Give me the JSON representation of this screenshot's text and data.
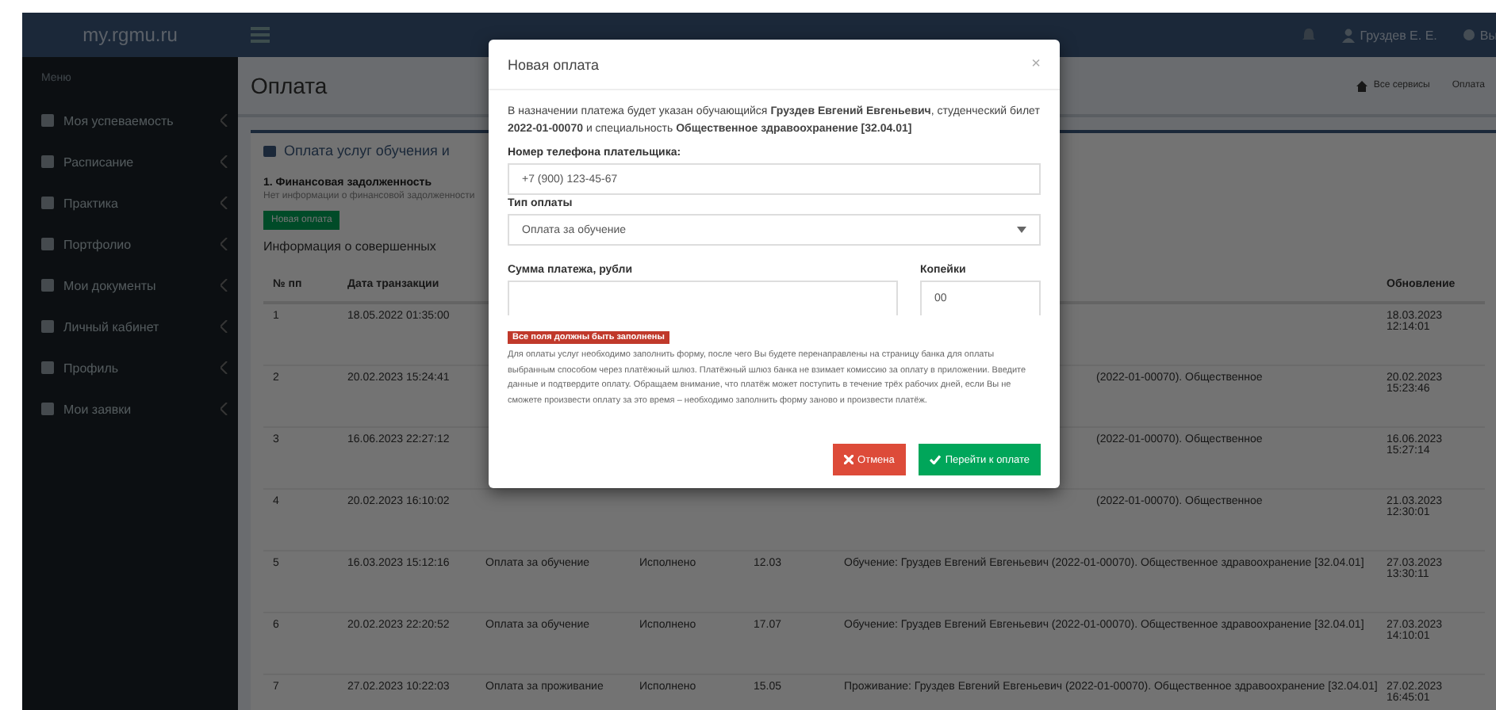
{
  "header": {
    "logo": "my.rgmu.ru",
    "user": "Груздев Е. Е.",
    "logout": "Вы"
  },
  "sidebar": {
    "heading": "Меню",
    "items": [
      {
        "label": "Моя успеваемость"
      },
      {
        "label": "Расписание"
      },
      {
        "label": "Практика"
      },
      {
        "label": "Портфолио"
      },
      {
        "label": "Мои документы"
      },
      {
        "label": "Личный кабинет"
      },
      {
        "label": "Профиль"
      },
      {
        "label": "Мои заявки"
      }
    ]
  },
  "page": {
    "title": "Оплата",
    "breadcrumb": [
      "Все сервисы",
      "Оплата"
    ]
  },
  "panel": {
    "title": "Оплата услуг обучения и",
    "section": "1. Финансовая задолженность",
    "note": "Нет информации о финансовой задолженности",
    "new_button": "Новая оплата",
    "history_title": "Информация о совершенных"
  },
  "table": {
    "columns": {
      "number": "№ пп",
      "date": "Дата транзакции",
      "updated": "Обновление"
    },
    "rows": [
      {
        "number": "1",
        "date": "18.05.2022 01:35:00",
        "updated": "18.03.2023 12:14:01"
      },
      {
        "number": "2",
        "date": "20.02.2023 15:24:41",
        "tail": "(2022-01-00070). Общественное",
        "updated": "20.02.2023 15:23:46"
      },
      {
        "number": "3",
        "date": "16.06.2023 22:27:12",
        "tail": "(2022-01-00070). Общественное",
        "updated": "16.06.2023 15:27:14"
      },
      {
        "number": "4",
        "date": "20.02.2023 16:10:02",
        "tail": "(2022-01-00070). Общественное",
        "updated": "21.03.2023 12:30:01"
      },
      {
        "number": "5",
        "date": "16.03.2023 15:12:16",
        "type": "Оплата за обучение",
        "status": "Исполнено",
        "sum": "12.03",
        "purpose": "Обучение: Груздев Евгений Евгеньевич (2022-01-00070). Общественное здравоохранение [32.04.01]",
        "updated": "27.03.2023 13:30:11"
      },
      {
        "number": "6",
        "date": "20.02.2023 22:20:52",
        "type": "Оплата за обучение",
        "status": "Исполнено",
        "sum": "17.07",
        "purpose": "Обучение: Груздев Евгений Евгеньевич (2022-01-00070). Общественное здравоохранение [32.04.01]",
        "updated": "27.03.2023 14:10:01"
      },
      {
        "number": "7",
        "date": "27.02.2023 10:22:03",
        "type": "Оплата за проживание",
        "status": "Исполнено",
        "sum": "15.05",
        "purpose": "Проживание: Груздев Евгений Евгеньевич (2022-01-00070). Общественное здравоохранение [32.04.01]",
        "updated": "27.02.2023 16:45:01"
      }
    ]
  },
  "modal": {
    "title": "Новая оплата",
    "close": "×",
    "intro": "В назначении платежа будет указан обучающийся **Груздев Евгений Евгеньевич**, студенческий билет **2022-01-00070** и специальность **Общественное здравоохранение [32.04.01]**",
    "phone_label": "Номер телефона плательщика:",
    "phone_value": "+7 (900) 123-45-67",
    "type_label": "Тип оплаты",
    "type_value": "Оплата за обучение",
    "sum_label": "Сумма платежа, рубли",
    "kopeks_label": "Копейки",
    "kopeks_value": "00",
    "error": "Все поля должны быть заполнены",
    "info": "Для оплаты услуг необходимо заполнить форму, после чего Вы будете перенаправлены на страницу банка для оплаты выбранным способом через платёжный шлюз. Платёжный шлюз банка не взимает комиссию за оплату в приложении. Введите данные и подтвердите оплату. Обращаем внимание, что платёж может поступить в течение трёх рабочих дней, если Вы не сможете произвести оплату за это время – необходимо заполнить форму заново и произвести платёж.",
    "cancel": "Отмена",
    "submit": "Перейти к оплате"
  }
}
